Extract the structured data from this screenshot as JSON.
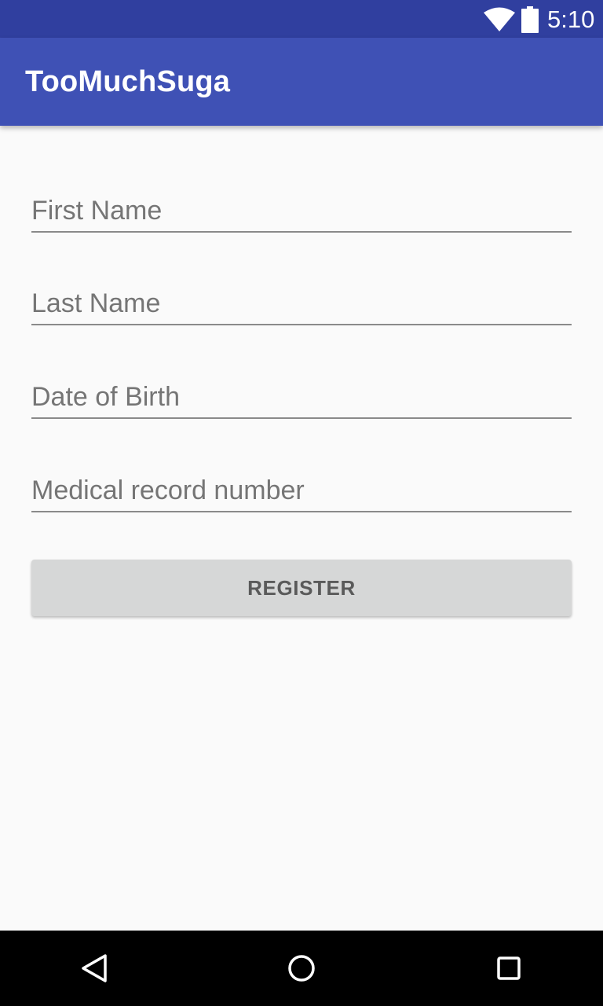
{
  "status_bar": {
    "time": "5:10",
    "icons": [
      "wifi-icon",
      "battery-icon"
    ]
  },
  "app_bar": {
    "title": "TooMuchSuga"
  },
  "form": {
    "first_name": {
      "placeholder": "First Name",
      "value": ""
    },
    "last_name": {
      "placeholder": "Last Name",
      "value": ""
    },
    "date_of_birth": {
      "placeholder": "Date of Birth",
      "value": ""
    },
    "medical_record_number": {
      "placeholder": "Medical record number",
      "value": ""
    },
    "register_label": "REGISTER"
  },
  "nav_bar": {
    "icons": [
      "back-icon",
      "home-icon",
      "recents-icon"
    ]
  },
  "colors": {
    "status_bar": "#303f9f",
    "primary": "#3f51b5",
    "background": "#fafafa",
    "button": "#d6d7d7",
    "button_text": "#5a5a5a",
    "hint_text": "#757575",
    "underline": "#8a8a8a"
  }
}
